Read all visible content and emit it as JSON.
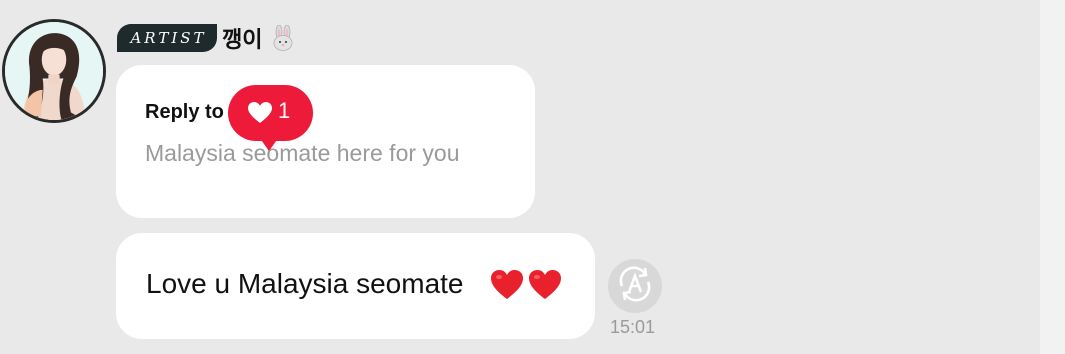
{
  "artist_post": {
    "badge_label": "ARTIST",
    "name": "깽이",
    "name_emoji_icon": "rabbit-icon",
    "avatar_icon": "profile-photo"
  },
  "reply_bubble": {
    "label": "Reply to",
    "quote": "Malaysia seomate here for you",
    "likes": {
      "count": "1",
      "icon": "heart-icon",
      "color": "#ee1a3a"
    }
  },
  "message": {
    "text": "Love u Malaysia seomate",
    "emoji": "red-heart-icons",
    "timestamp": "15:01",
    "translate_icon": "translate-icon"
  }
}
